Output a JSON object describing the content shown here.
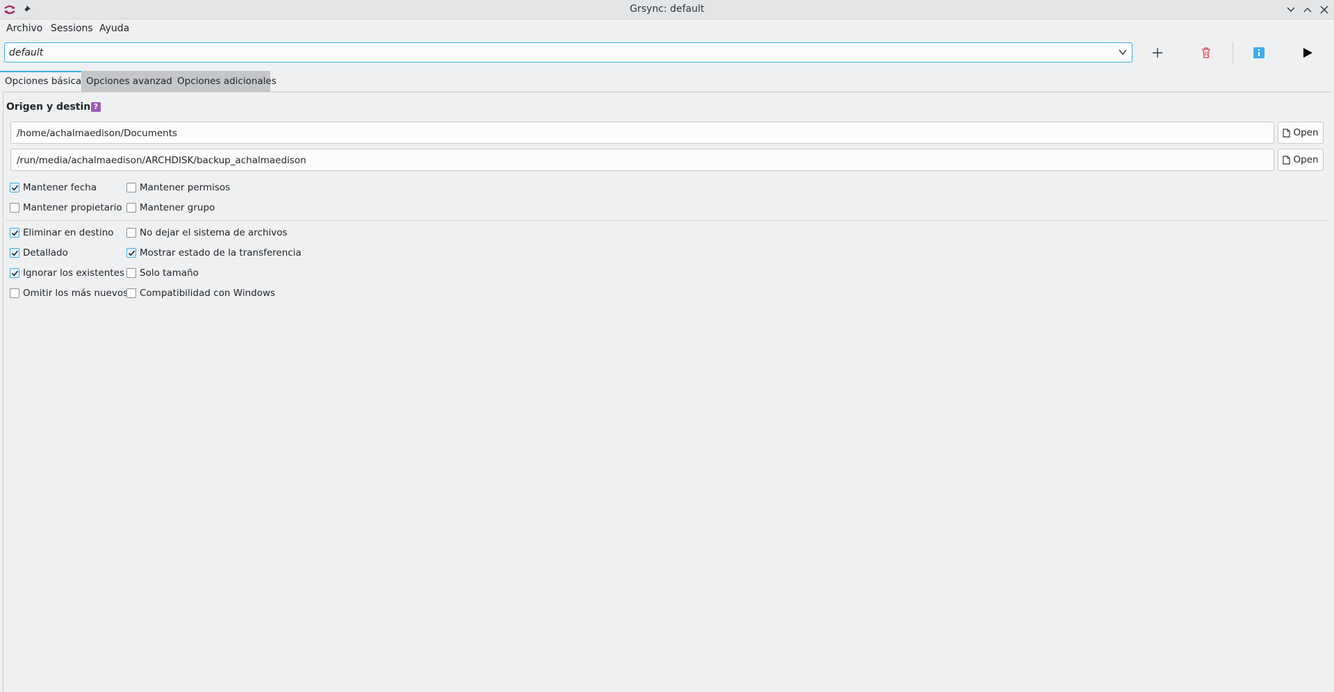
{
  "window": {
    "title": "Grsync: default",
    "app_icon": "grsync-logo",
    "pin_icon": "pin-icon",
    "controls": [
      "minimize-icon",
      "maximize-icon",
      "close-icon"
    ]
  },
  "menubar": {
    "items": [
      {
        "label": "Archivo"
      },
      {
        "label": "Sessions"
      },
      {
        "label": "Ayuda"
      }
    ]
  },
  "session": {
    "value": "default"
  },
  "toolbar": {
    "add_icon": "plus-icon",
    "delete_icon": "trash-icon",
    "info_icon": "info-icon",
    "run_icon": "play-icon",
    "colors": {
      "delete": "#da4453",
      "info": "#3daee9"
    }
  },
  "tabs": [
    {
      "label": "Opciones básicas",
      "active": true
    },
    {
      "label": "Opciones avanzadas",
      "active": false
    },
    {
      "label": "Opciones adicionales",
      "active": false
    }
  ],
  "basic": {
    "section_label": "Origen y destino:",
    "help_label": "?",
    "source_path": "/home/achalmaedison/Documents",
    "dest_path": "/run/media/achalmaedison/ARCHDISK/backup_achalmaedison",
    "open_label": "Open",
    "checkboxes": [
      {
        "label": "Mantener fecha",
        "checked": true
      },
      {
        "label": "Mantener permisos",
        "checked": false
      },
      {
        "label": "Mantener propietario",
        "checked": false
      },
      {
        "label": "Mantener grupo",
        "checked": false
      },
      {
        "label": "Eliminar en destino",
        "checked": true
      },
      {
        "label": "No dejar el sistema de archivos",
        "checked": false
      },
      {
        "label": "Detallado",
        "checked": true
      },
      {
        "label": "Mostrar estado de la transferencia",
        "checked": true
      },
      {
        "label": "Ignorar los existentes",
        "checked": true
      },
      {
        "label": "Solo tamaño",
        "checked": false
      },
      {
        "label": "Omitir los más nuevos",
        "checked": false
      },
      {
        "label": "Compatibilidad con Windows",
        "checked": false
      }
    ]
  },
  "accent_color": "#3daee9"
}
